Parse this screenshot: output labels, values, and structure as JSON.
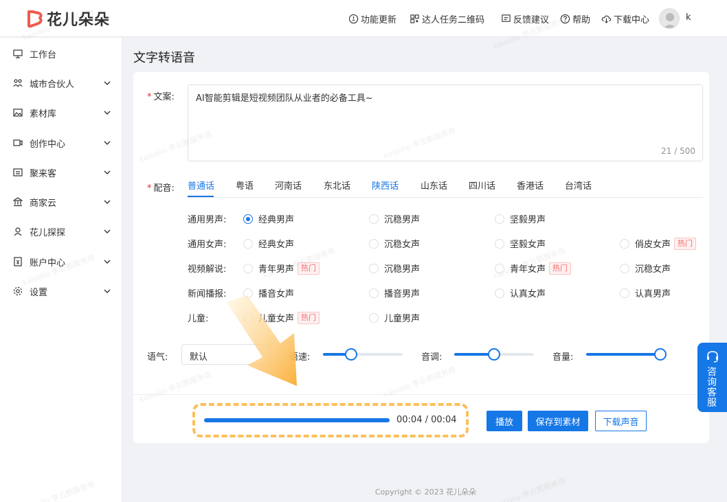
{
  "brand": {
    "name": "花儿朵朵"
  },
  "header": {
    "nav": [
      {
        "label": "功能更新",
        "icon": "lightbulb-icon"
      },
      {
        "label": "达人任务二维码",
        "icon": "qrcode-icon"
      },
      {
        "label": "反馈建议",
        "icon": "feedback-icon"
      },
      {
        "label": "帮助",
        "icon": "help-icon"
      },
      {
        "label": "下载中心",
        "icon": "cloud-download-icon"
      }
    ],
    "user_initial": "k"
  },
  "sidebar": {
    "items": [
      {
        "label": "工作台",
        "icon": "monitor-icon",
        "expandable": false
      },
      {
        "label": "城市合伙人",
        "icon": "partner-icon",
        "expandable": true
      },
      {
        "label": "素材库",
        "icon": "image-icon",
        "expandable": true
      },
      {
        "label": "创作中心",
        "icon": "video-icon",
        "expandable": true
      },
      {
        "label": "聚来客",
        "icon": "customer-icon",
        "expandable": true
      },
      {
        "label": "商家云",
        "icon": "bank-icon",
        "expandable": true
      },
      {
        "label": "花儿探探",
        "icon": "explore-icon",
        "expandable": true
      },
      {
        "label": "账户中心",
        "icon": "account-icon",
        "expandable": true
      },
      {
        "label": "设置",
        "icon": "gear-icon",
        "expandable": true
      }
    ]
  },
  "page": {
    "title": "文字转语音"
  },
  "form": {
    "script_label": "文案:",
    "script_value": "AI智能剪辑是短视频团队从业者的必备工具~",
    "script_counter": "21 / 500",
    "voice_label": "配音:",
    "dialect_tabs": [
      {
        "label": "普通话",
        "active": true
      },
      {
        "label": "粤语",
        "active": false
      },
      {
        "label": "河南话",
        "active": false
      },
      {
        "label": "东北话",
        "active": false
      },
      {
        "label": "陕西话",
        "active": false,
        "highlight": true
      },
      {
        "label": "山东话",
        "active": false
      },
      {
        "label": "四川话",
        "active": false
      },
      {
        "label": "香港话",
        "active": false
      },
      {
        "label": "台湾话",
        "active": false
      }
    ],
    "hot_badge": "热门",
    "voice_groups": [
      {
        "label": "通用男声:",
        "options": [
          {
            "label": "经典男声",
            "checked": true,
            "hot": false
          },
          {
            "label": "沉稳男声",
            "checked": false,
            "hot": false
          },
          {
            "label": "坚毅男声",
            "checked": false,
            "hot": false
          }
        ]
      },
      {
        "label": "通用女声:",
        "options": [
          {
            "label": "经典女声",
            "checked": false,
            "hot": false
          },
          {
            "label": "沉稳女声",
            "checked": false,
            "hot": false
          },
          {
            "label": "坚毅女声",
            "checked": false,
            "hot": false
          },
          {
            "label": "俏皮女声",
            "checked": false,
            "hot": true
          }
        ]
      },
      {
        "label": "视频解说:",
        "options": [
          {
            "label": "青年男声",
            "checked": false,
            "hot": true
          },
          {
            "label": "沉稳男声",
            "checked": false,
            "hot": false
          },
          {
            "label": "青年女声",
            "checked": false,
            "hot": true
          },
          {
            "label": "沉稳女声",
            "checked": false,
            "hot": false
          }
        ]
      },
      {
        "label": "新闻播报:",
        "options": [
          {
            "label": "播音女声",
            "checked": false,
            "hot": false
          },
          {
            "label": "播音男声",
            "checked": false,
            "hot": false
          },
          {
            "label": "认真女声",
            "checked": false,
            "hot": false
          },
          {
            "label": "认真男声",
            "checked": false,
            "hot": false
          }
        ]
      },
      {
        "label": "儿童:",
        "options": [
          {
            "label": "儿童女声",
            "checked": false,
            "hot": true
          },
          {
            "label": "儿童男声",
            "checked": false,
            "hot": false
          }
        ]
      }
    ],
    "tone_label": "语气:",
    "tone_value": "默认",
    "speed_label": "语速:",
    "speed_level": 0.35,
    "pitch_label": "音调:",
    "pitch_level": 0.5,
    "volume_label": "音量:",
    "volume_level": 0.93
  },
  "player": {
    "progress": 1.0,
    "time": "00:04 / 00:04"
  },
  "actions": {
    "play": "播放",
    "save": "保存到素材",
    "download": "下载声音"
  },
  "floating": {
    "label": "咨询客服"
  },
  "footer": {
    "copyright": "Copyright © 2023 花儿朵朵"
  },
  "watermark": {
    "text": "kaisolio 李云鹏服务商"
  },
  "colors": {
    "accent": "#1677e6",
    "highlight": "#fbbf5a",
    "hot": "#f56c6c"
  }
}
